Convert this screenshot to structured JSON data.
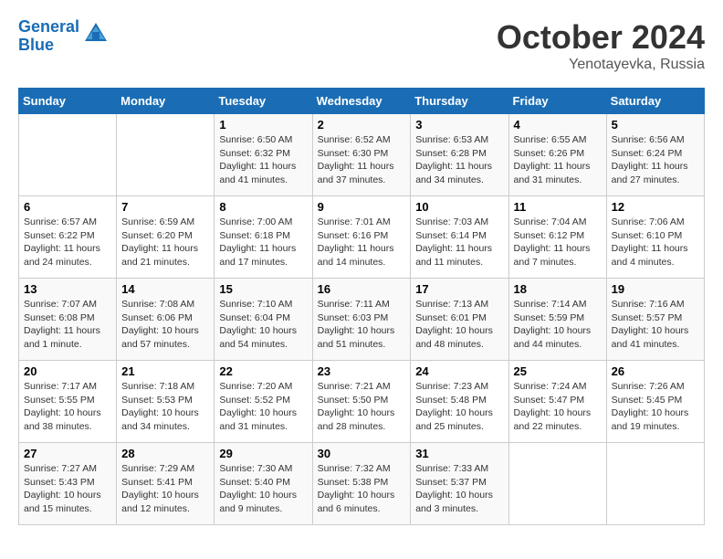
{
  "header": {
    "logo_line1": "General",
    "logo_line2": "Blue",
    "month_title": "October 2024",
    "subtitle": "Yenotayevka, Russia"
  },
  "weekdays": [
    "Sunday",
    "Monday",
    "Tuesday",
    "Wednesday",
    "Thursday",
    "Friday",
    "Saturday"
  ],
  "weeks": [
    [
      {
        "day": "",
        "info": ""
      },
      {
        "day": "",
        "info": ""
      },
      {
        "day": "1",
        "info": "Sunrise: 6:50 AM\nSunset: 6:32 PM\nDaylight: 11 hours and 41 minutes."
      },
      {
        "day": "2",
        "info": "Sunrise: 6:52 AM\nSunset: 6:30 PM\nDaylight: 11 hours and 37 minutes."
      },
      {
        "day": "3",
        "info": "Sunrise: 6:53 AM\nSunset: 6:28 PM\nDaylight: 11 hours and 34 minutes."
      },
      {
        "day": "4",
        "info": "Sunrise: 6:55 AM\nSunset: 6:26 PM\nDaylight: 11 hours and 31 minutes."
      },
      {
        "day": "5",
        "info": "Sunrise: 6:56 AM\nSunset: 6:24 PM\nDaylight: 11 hours and 27 minutes."
      }
    ],
    [
      {
        "day": "6",
        "info": "Sunrise: 6:57 AM\nSunset: 6:22 PM\nDaylight: 11 hours and 24 minutes."
      },
      {
        "day": "7",
        "info": "Sunrise: 6:59 AM\nSunset: 6:20 PM\nDaylight: 11 hours and 21 minutes."
      },
      {
        "day": "8",
        "info": "Sunrise: 7:00 AM\nSunset: 6:18 PM\nDaylight: 11 hours and 17 minutes."
      },
      {
        "day": "9",
        "info": "Sunrise: 7:01 AM\nSunset: 6:16 PM\nDaylight: 11 hours and 14 minutes."
      },
      {
        "day": "10",
        "info": "Sunrise: 7:03 AM\nSunset: 6:14 PM\nDaylight: 11 hours and 11 minutes."
      },
      {
        "day": "11",
        "info": "Sunrise: 7:04 AM\nSunset: 6:12 PM\nDaylight: 11 hours and 7 minutes."
      },
      {
        "day": "12",
        "info": "Sunrise: 7:06 AM\nSunset: 6:10 PM\nDaylight: 11 hours and 4 minutes."
      }
    ],
    [
      {
        "day": "13",
        "info": "Sunrise: 7:07 AM\nSunset: 6:08 PM\nDaylight: 11 hours and 1 minute."
      },
      {
        "day": "14",
        "info": "Sunrise: 7:08 AM\nSunset: 6:06 PM\nDaylight: 10 hours and 57 minutes."
      },
      {
        "day": "15",
        "info": "Sunrise: 7:10 AM\nSunset: 6:04 PM\nDaylight: 10 hours and 54 minutes."
      },
      {
        "day": "16",
        "info": "Sunrise: 7:11 AM\nSunset: 6:03 PM\nDaylight: 10 hours and 51 minutes."
      },
      {
        "day": "17",
        "info": "Sunrise: 7:13 AM\nSunset: 6:01 PM\nDaylight: 10 hours and 48 minutes."
      },
      {
        "day": "18",
        "info": "Sunrise: 7:14 AM\nSunset: 5:59 PM\nDaylight: 10 hours and 44 minutes."
      },
      {
        "day": "19",
        "info": "Sunrise: 7:16 AM\nSunset: 5:57 PM\nDaylight: 10 hours and 41 minutes."
      }
    ],
    [
      {
        "day": "20",
        "info": "Sunrise: 7:17 AM\nSunset: 5:55 PM\nDaylight: 10 hours and 38 minutes."
      },
      {
        "day": "21",
        "info": "Sunrise: 7:18 AM\nSunset: 5:53 PM\nDaylight: 10 hours and 34 minutes."
      },
      {
        "day": "22",
        "info": "Sunrise: 7:20 AM\nSunset: 5:52 PM\nDaylight: 10 hours and 31 minutes."
      },
      {
        "day": "23",
        "info": "Sunrise: 7:21 AM\nSunset: 5:50 PM\nDaylight: 10 hours and 28 minutes."
      },
      {
        "day": "24",
        "info": "Sunrise: 7:23 AM\nSunset: 5:48 PM\nDaylight: 10 hours and 25 minutes."
      },
      {
        "day": "25",
        "info": "Sunrise: 7:24 AM\nSunset: 5:47 PM\nDaylight: 10 hours and 22 minutes."
      },
      {
        "day": "26",
        "info": "Sunrise: 7:26 AM\nSunset: 5:45 PM\nDaylight: 10 hours and 19 minutes."
      }
    ],
    [
      {
        "day": "27",
        "info": "Sunrise: 7:27 AM\nSunset: 5:43 PM\nDaylight: 10 hours and 15 minutes."
      },
      {
        "day": "28",
        "info": "Sunrise: 7:29 AM\nSunset: 5:41 PM\nDaylight: 10 hours and 12 minutes."
      },
      {
        "day": "29",
        "info": "Sunrise: 7:30 AM\nSunset: 5:40 PM\nDaylight: 10 hours and 9 minutes."
      },
      {
        "day": "30",
        "info": "Sunrise: 7:32 AM\nSunset: 5:38 PM\nDaylight: 10 hours and 6 minutes."
      },
      {
        "day": "31",
        "info": "Sunrise: 7:33 AM\nSunset: 5:37 PM\nDaylight: 10 hours and 3 minutes."
      },
      {
        "day": "",
        "info": ""
      },
      {
        "day": "",
        "info": ""
      }
    ]
  ]
}
